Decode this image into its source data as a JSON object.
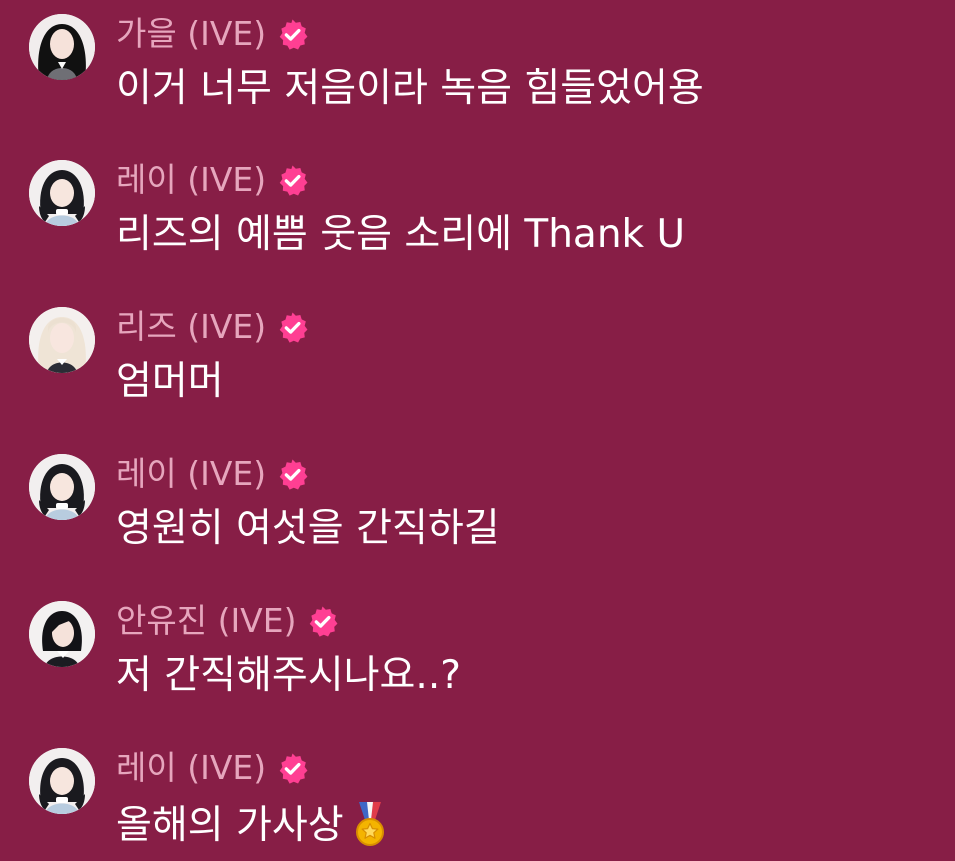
{
  "chat": {
    "messages": [
      {
        "author": "가을 (IVE)",
        "text": "이거 너무 저음이라 녹음 힘들었어용",
        "avatar": "avatar-gaeul"
      },
      {
        "author": "레이 (IVE)",
        "text": "리즈의 예쁨 웃음 소리에 Thank U",
        "avatar": "avatar-rei"
      },
      {
        "author": "리즈 (IVE)",
        "text": "엄머머",
        "avatar": "avatar-liz"
      },
      {
        "author": "레이 (IVE)",
        "text": "영원히 여섯을 간직하길",
        "avatar": "avatar-rei"
      },
      {
        "author": "안유진 (IVE)",
        "text": "저 간직해주시나요..?",
        "avatar": "avatar-anyujin"
      },
      {
        "author": "레이 (IVE)",
        "text": "올해의 가사상",
        "avatar": "avatar-rei",
        "emoji": "medal-emoji"
      }
    ]
  },
  "colors": {
    "background": "#871e46",
    "author_name": "#e6a6bd",
    "message_text": "#ffffff",
    "verified_badge": "#ff3f93"
  }
}
